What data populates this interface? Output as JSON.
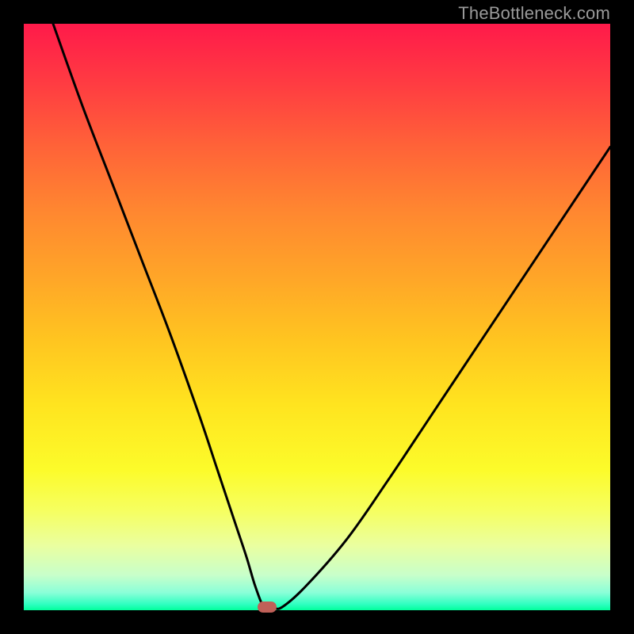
{
  "watermark": "TheBottleneck.com",
  "chart_data": {
    "type": "line",
    "title": "",
    "xlabel": "",
    "ylabel": "",
    "xlim": [
      0,
      100
    ],
    "ylim": [
      0,
      100
    ],
    "series": [
      {
        "name": "bottleneck-curve",
        "x": [
          5,
          10,
          15,
          20,
          25,
          30,
          33,
          36,
          38,
          39.5,
          41,
          42.5,
          44,
          48,
          55,
          62,
          70,
          78,
          86,
          94,
          100
        ],
        "values": [
          100,
          86,
          73,
          60,
          47,
          33,
          24,
          15,
          9,
          4,
          0.5,
          0.5,
          0.5,
          4,
          12,
          22,
          34,
          46,
          58,
          70,
          79
        ]
      }
    ],
    "marker": {
      "x": 41.5,
      "y": 0.5
    },
    "grid": false,
    "legend": false
  }
}
